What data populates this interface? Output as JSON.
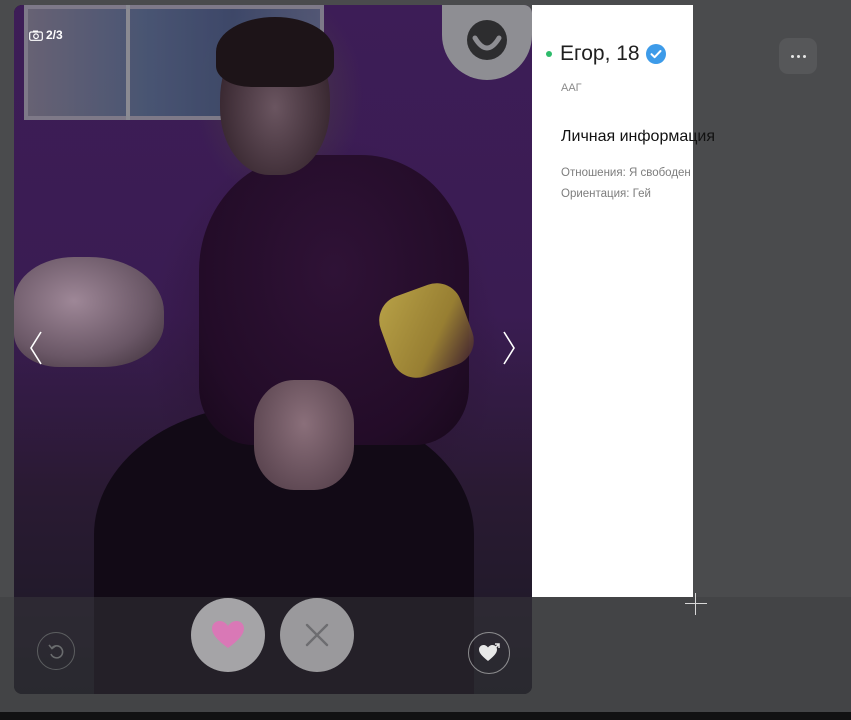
{
  "photo": {
    "counter": "2/3",
    "camera_icon": "camera-icon",
    "prev_icon": "chevron-left-icon",
    "next_icon": "chevron-right-icon",
    "badge_icon": "smile-badge-icon"
  },
  "profile": {
    "name": "Егор, 18",
    "online": true,
    "verified_icon": "verified-check-icon",
    "subtitle": "ААГ",
    "section_title": "Личная информация",
    "relationship": "Отношения: Я свободен",
    "orientation": "Ориентация: Гей"
  },
  "actions": {
    "like_icon": "heart-icon",
    "dislike_icon": "close-icon",
    "undo_icon": "undo-icon",
    "superlike_icon": "heart-arrow-icon",
    "menu_icon": "more-horizontal-icon"
  },
  "colors": {
    "online": "#2dbb6b",
    "verified": "#3d9be9",
    "like_heart": "#d978b6",
    "panel_bg": "#ffffff"
  }
}
